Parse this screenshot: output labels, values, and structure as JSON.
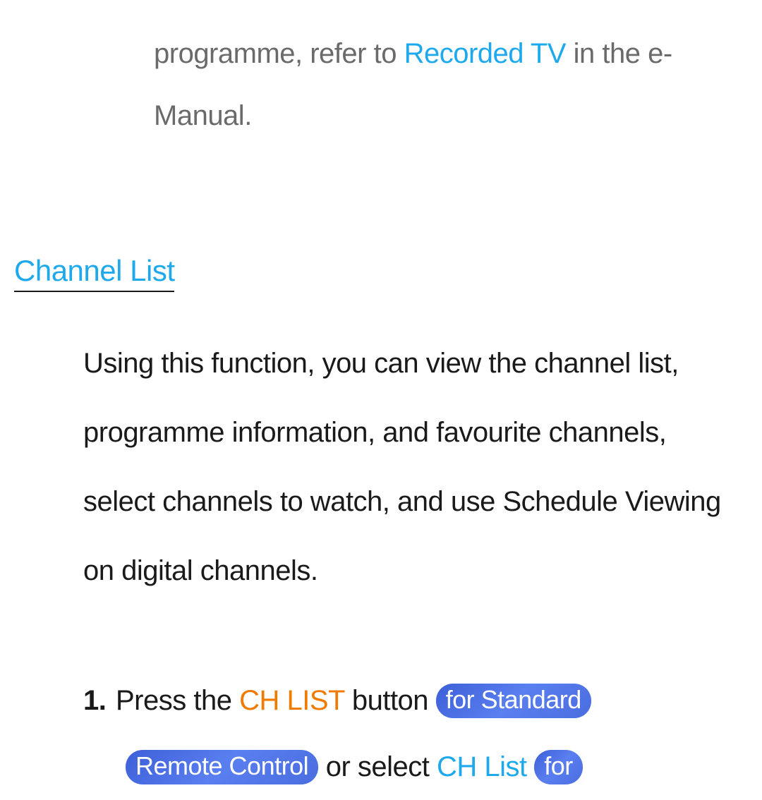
{
  "fragment": {
    "part1": "programme, refer to ",
    "link": "Recorded TV",
    "part2": " in the e-Manual."
  },
  "heading": "Channel List",
  "description": "Using this function, you can view the channel list, programme information, and favourite channels, select channels to watch, and use Schedule Viewing on digital channels.",
  "step": {
    "number": "1.",
    "part1": "Press the ",
    "chlist_button": "CH LIST",
    "part2": " button ",
    "pill1": "for Standard",
    "pill2": "Remote Control",
    "part3": " or select ",
    "chlist_link": "CH List",
    "part4": " ",
    "pill3": "for"
  }
}
